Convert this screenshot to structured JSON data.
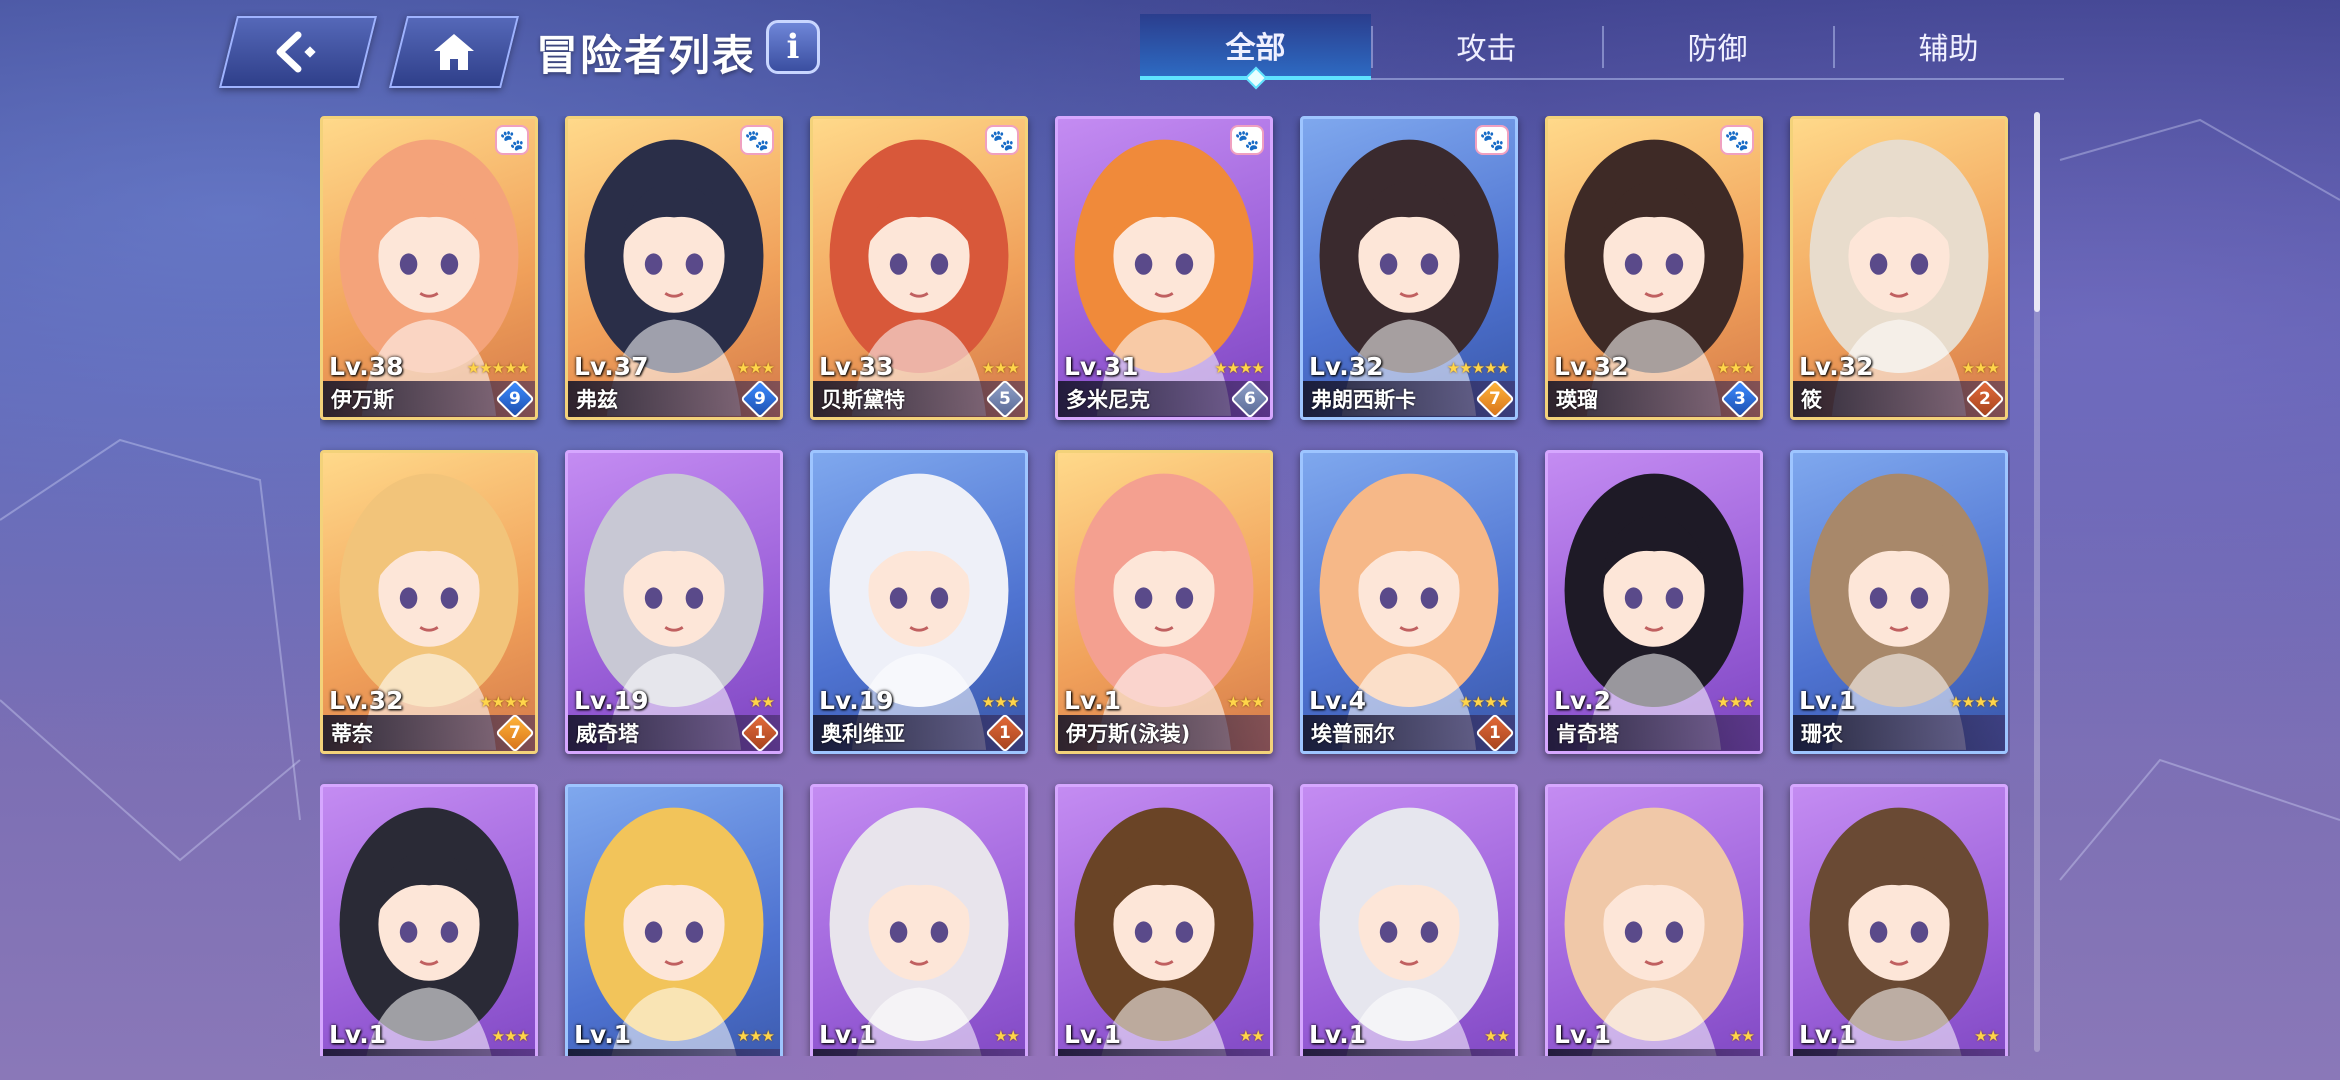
{
  "header": {
    "title": "冒险者列表",
    "info_label": "i",
    "tabs": [
      {
        "label": "全部",
        "active": true
      },
      {
        "label": "攻击",
        "active": false
      },
      {
        "label": "防御",
        "active": false
      },
      {
        "label": "辅助",
        "active": false
      }
    ]
  },
  "cards": [
    {
      "level": "Lv.38",
      "name": "伊万斯",
      "stars": "★★★★★",
      "grade": "9",
      "grade_color": "blue",
      "rarity": "gold",
      "pet": true,
      "hair": "#f4a37a"
    },
    {
      "level": "Lv.37",
      "name": "弗兹",
      "stars": "★★★",
      "grade": "9",
      "grade_color": "blue",
      "rarity": "gold",
      "pet": true,
      "hair": "#2a2e48"
    },
    {
      "level": "Lv.33",
      "name": "贝斯黛特",
      "stars": "★★★",
      "grade": "5",
      "grade_color": "gray",
      "rarity": "gold",
      "pet": true,
      "hair": "#d8583a"
    },
    {
      "level": "Lv.31",
      "name": "多米尼克",
      "stars": "★★★★",
      "grade": "6",
      "grade_color": "gray",
      "rarity": "purple",
      "pet": true,
      "hair": "#f08a3a"
    },
    {
      "level": "Lv.32",
      "name": "弗朗西斯卡",
      "stars": "★★★★★",
      "grade": "7",
      "grade_color": "gold",
      "rarity": "blue",
      "pet": true,
      "hair": "#3a2a2e"
    },
    {
      "level": "Lv.32",
      "name": "瑛瑠",
      "stars": "★★★",
      "grade": "3",
      "grade_color": "blue",
      "rarity": "gold",
      "pet": true,
      "hair": "#3e2a26"
    },
    {
      "level": "Lv.32",
      "name": "筱",
      "stars": "★★★",
      "grade": "2",
      "grade_color": "orange",
      "rarity": "gold",
      "pet": false,
      "hair": "#e8dccc"
    },
    {
      "level": "Lv.32",
      "name": "蒂奈",
      "stars": "★★★★",
      "grade": "7",
      "grade_color": "gold",
      "rarity": "gold",
      "pet": false,
      "hair": "#f2c47a"
    },
    {
      "level": "Lv.19",
      "name": "威奇塔",
      "stars": "★★",
      "grade": "1",
      "grade_color": "orange",
      "rarity": "purple",
      "pet": false,
      "hair": "#c8c8d4"
    },
    {
      "level": "Lv.19",
      "name": "奥利维亚",
      "stars": "★★★",
      "grade": "1",
      "grade_color": "orange",
      "rarity": "blue",
      "pet": false,
      "hair": "#eef0f8"
    },
    {
      "level": "Lv.1",
      "name": "伊万斯(泳装)",
      "stars": "★★★",
      "grade": "",
      "grade_color": "none",
      "rarity": "gold",
      "pet": false,
      "hair": "#f4a090"
    },
    {
      "level": "Lv.4",
      "name": "埃普丽尔",
      "stars": "★★★★",
      "grade": "1",
      "grade_color": "orange",
      "rarity": "blue",
      "pet": false,
      "hair": "#f6b888"
    },
    {
      "level": "Lv.2",
      "name": "肯奇塔",
      "stars": "★★★",
      "grade": "",
      "grade_color": "none",
      "rarity": "purple",
      "pet": false,
      "hair": "#1e1a26"
    },
    {
      "level": "Lv.1",
      "name": "珊农",
      "stars": "★★★★",
      "grade": "",
      "grade_color": "none",
      "rarity": "blue",
      "pet": false,
      "hair": "#a8886a"
    },
    {
      "level": "Lv.1",
      "name": "",
      "stars": "★★★",
      "grade": "",
      "grade_color": "none",
      "rarity": "purple",
      "pet": false,
      "hair": "#2a2a36"
    },
    {
      "level": "Lv.1",
      "name": "",
      "stars": "★★★",
      "grade": "",
      "grade_color": "none",
      "rarity": "blue",
      "pet": false,
      "hair": "#f2c45a"
    },
    {
      "level": "Lv.1",
      "name": "",
      "stars": "★★",
      "grade": "",
      "grade_color": "none",
      "rarity": "purple",
      "pet": false,
      "hair": "#e8e4ec"
    },
    {
      "level": "Lv.1",
      "name": "",
      "stars": "★★",
      "grade": "",
      "grade_color": "none",
      "rarity": "purple",
      "pet": false,
      "hair": "#6a4426"
    },
    {
      "level": "Lv.1",
      "name": "",
      "stars": "★★",
      "grade": "",
      "grade_color": "none",
      "rarity": "purple",
      "pet": false,
      "hair": "#e6e6ee"
    },
    {
      "level": "Lv.1",
      "name": "",
      "stars": "★★",
      "grade": "",
      "grade_color": "none",
      "rarity": "purple",
      "pet": false,
      "hair": "#f0c8a8"
    },
    {
      "level": "Lv.1",
      "name": "",
      "stars": "★★",
      "grade": "",
      "grade_color": "none",
      "rarity": "purple",
      "pet": false,
      "hair": "#6a4a34"
    }
  ],
  "colors": {
    "accent": "#5fe3ff",
    "rarity_gold": "#f3d27a",
    "rarity_purple": "#d6a7ff",
    "rarity_blue": "#9ec5ff"
  },
  "icons": {
    "back": "back-arrow-icon",
    "home": "home-icon",
    "info": "info-icon",
    "pet": "paw-icon"
  }
}
